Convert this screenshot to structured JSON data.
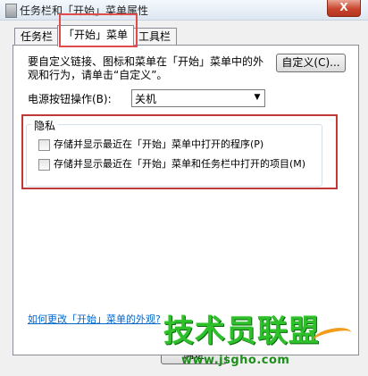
{
  "window": {
    "title": "任务栏和「开始」菜单属性",
    "close_glyph": "X"
  },
  "tabs": [
    {
      "label": "任务栏",
      "active": false
    },
    {
      "label": "「开始」菜单",
      "active": true
    },
    {
      "label": "工具栏",
      "active": false
    }
  ],
  "start_menu": {
    "description": "要自定义链接、图标和菜单在「开始」菜单中的外观和行为，请单击“自定义”。",
    "customize_label": "自定义(C)...",
    "power_label": "电源按钮操作(B):",
    "power_value": "关机",
    "privacy_title": "隐私",
    "privacy_options": [
      {
        "label": "存储并显示最近在「开始」菜单中打开的程序(P)",
        "checked": false
      },
      {
        "label": "存储并显示最近在「开始」菜单和任务栏中打开的项目(M)",
        "checked": false
      }
    ],
    "help_link": "如何更改「开始」菜单的外观?"
  },
  "footer": {
    "ok_label": "确定"
  },
  "watermark": {
    "brand": "技术员联盟",
    "url": "www.jsgho.com"
  },
  "colors": {
    "annotation_red": "#e04b4b",
    "watermark_green": "#2ec02a",
    "link_blue": "#0066cc"
  }
}
